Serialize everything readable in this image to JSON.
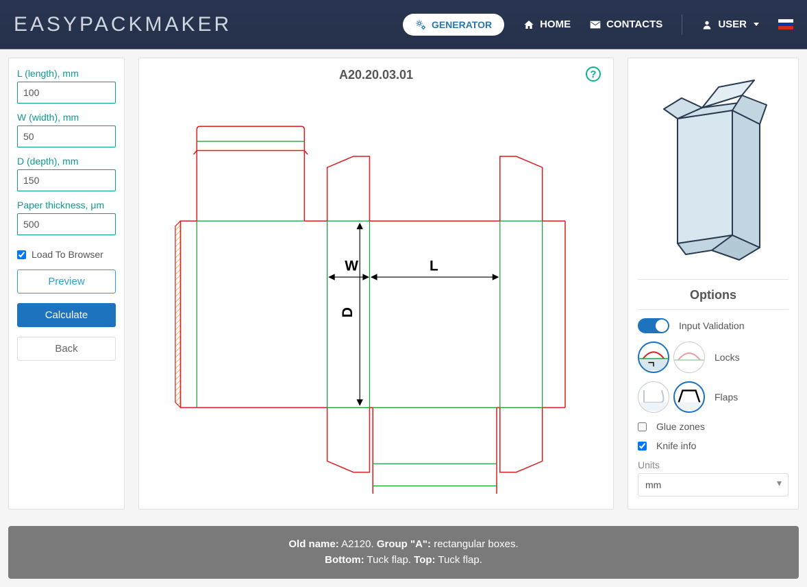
{
  "brand": "EasyPackMaker",
  "nav": {
    "generator": "GENERATOR",
    "home": "HOME",
    "contacts": "CONTACTS",
    "user": "USER"
  },
  "inputs": {
    "length_label": "L (length), mm",
    "length_value": "100",
    "width_label": "W (width), mm",
    "width_value": "50",
    "depth_label": "D (depth), mm",
    "depth_value": "150",
    "thickness_label": "Paper thickness, μm",
    "thickness_value": "500",
    "load_to_browser": "Load To Browser"
  },
  "buttons": {
    "preview": "Preview",
    "calculate": "Calculate",
    "back": "Back"
  },
  "template_code": "A20.20.03.01",
  "dieline_labels": {
    "W": "W",
    "L": "L",
    "D": "D"
  },
  "options": {
    "title": "Options",
    "input_validation": "Input Validation",
    "locks": "Locks",
    "flaps": "Flaps",
    "glue_zones": "Glue zones",
    "knife_info": "Knife info",
    "units_label": "Units",
    "units_value": "mm"
  },
  "footer": {
    "old_name_label": "Old name:",
    "old_name_value": "A2120.",
    "group_label": "Group \"A\":",
    "group_value": "rectangular boxes.",
    "bottom_label": "Bottom:",
    "bottom_value": "Tuck flap.",
    "top_label": "Top:",
    "top_value": "Tuck flap."
  }
}
